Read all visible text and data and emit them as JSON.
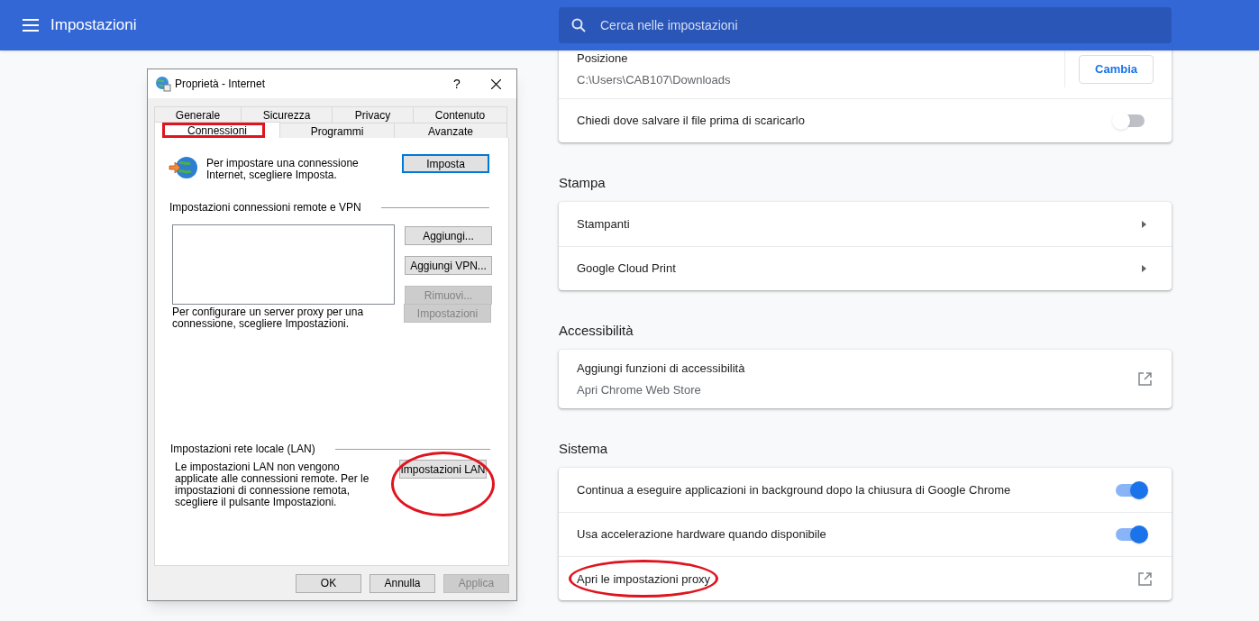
{
  "header": {
    "title": "Impostazioni",
    "search": {
      "placeholder": "Cerca nelle impostazioni"
    }
  },
  "sections": [
    {
      "rows": [
        {
          "kind": "button",
          "label": "Posizione",
          "secondary": "C:\\Users\\CAB107\\Downloads",
          "button": "Cambia"
        },
        {
          "kind": "toggle",
          "label": "Chiedi dove salvare il file prima di scaricarlo",
          "on": false
        }
      ]
    },
    {
      "heading": "Stampa",
      "rows": [
        {
          "kind": "arrow",
          "label": "Stampanti"
        },
        {
          "kind": "arrow",
          "label": "Google Cloud Print"
        }
      ]
    },
    {
      "heading": "Accessibilità",
      "rows": [
        {
          "kind": "external",
          "label": "Aggiungi funzioni di accessibilità",
          "secondary": "Apri Chrome Web Store"
        }
      ]
    },
    {
      "heading": "Sistema",
      "rows": [
        {
          "kind": "toggle",
          "label": "Continua a eseguire applicazioni in background dopo la chiusura di Google Chrome",
          "on": true
        },
        {
          "kind": "toggle",
          "label": "Usa accelerazione hardware quando disponibile",
          "on": true
        },
        {
          "kind": "external",
          "label": "Apri le impostazioni proxy",
          "circled": true
        }
      ]
    }
  ],
  "dialog": {
    "title": "Proprietà - Internet",
    "help": "?",
    "tab_rows": [
      [
        {
          "label": "Generale",
          "selected": false
        },
        {
          "label": "Sicurezza",
          "selected": false
        },
        {
          "label": "Privacy",
          "selected": false
        },
        {
          "label": "Contenuto",
          "selected": false
        }
      ],
      [
        {
          "label": "Connessioni",
          "selected": true,
          "boxed": true
        },
        {
          "label": "Programmi",
          "selected": false
        },
        {
          "label": "Avanzate",
          "selected": false
        }
      ]
    ],
    "setup_text": "Per impostare una connessione Internet, scegliere Imposta.",
    "setup_button": "Imposta",
    "remote_group": "Impostazioni connessioni remote e VPN",
    "remote_buttons": [
      {
        "label": "Aggiungi...",
        "disabled": false
      },
      {
        "label": "Aggiungi VPN...",
        "disabled": false
      },
      {
        "label": "Rimuovi...",
        "disabled": true
      }
    ],
    "proxy_text": "Per configurare un server proxy per una connessione, scegliere Impostazioni.",
    "proxy_button": {
      "label": "Impostazioni",
      "disabled": true
    },
    "lan_group": "Impostazioni rete locale (LAN)",
    "lan_text": "Le impostazioni LAN non vengono applicate alle connessioni remote. Per le impostazioni di connessione remota, scegliere il pulsante Impostazioni.",
    "lan_button": {
      "label": "Impostazioni LAN",
      "circled": true
    },
    "footer_buttons": [
      {
        "label": "OK",
        "disabled": false
      },
      {
        "label": "Annulla",
        "disabled": false
      },
      {
        "label": "Applica",
        "disabled": true
      }
    ]
  }
}
